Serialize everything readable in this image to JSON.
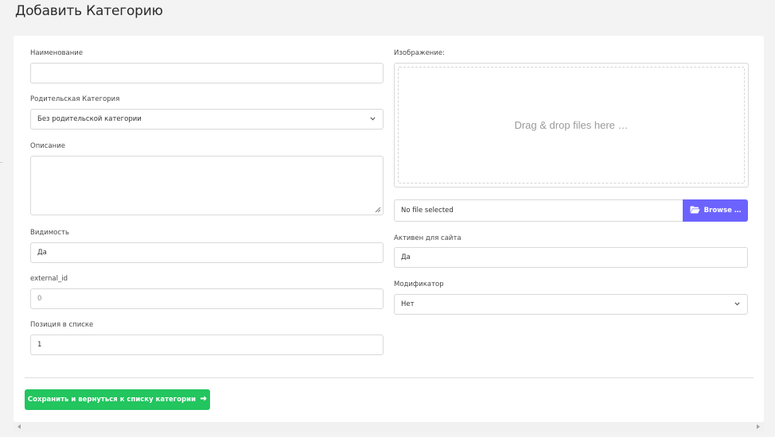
{
  "page": {
    "title": "Добавить Категорию"
  },
  "form": {
    "name": {
      "label": "Наименование",
      "value": ""
    },
    "parent_category": {
      "label": "Родительская Категория",
      "selected": "Без родительской категории",
      "icon": "chevron-down-icon"
    },
    "description": {
      "label": "Описание",
      "value": ""
    },
    "visibility": {
      "label": "Видимость",
      "value": "Да"
    },
    "external_id": {
      "label": "external_id",
      "value": "0"
    },
    "position": {
      "label": "Позиция в списке",
      "value": "1"
    },
    "image": {
      "label": "Изображение:",
      "dropzone_text": "Drag & drop files here …",
      "file_status": "No file selected",
      "browse_label": "Browse …",
      "browse_icon": "folder-open-icon"
    },
    "active_for_site": {
      "label": "Активен для сайта",
      "value": "Да"
    },
    "modifier": {
      "label": "Модификатор",
      "selected": "Нет",
      "icon": "chevron-down-icon"
    }
  },
  "actions": {
    "save_label": "Сохранить и вернуться к списку категории",
    "save_icon": "arrow-right-icon"
  },
  "colors": {
    "accent_browse": "#6c63ff",
    "accent_save": "#22c55e",
    "page_bg": "#f3f3f4",
    "card_bg": "#ffffff"
  }
}
